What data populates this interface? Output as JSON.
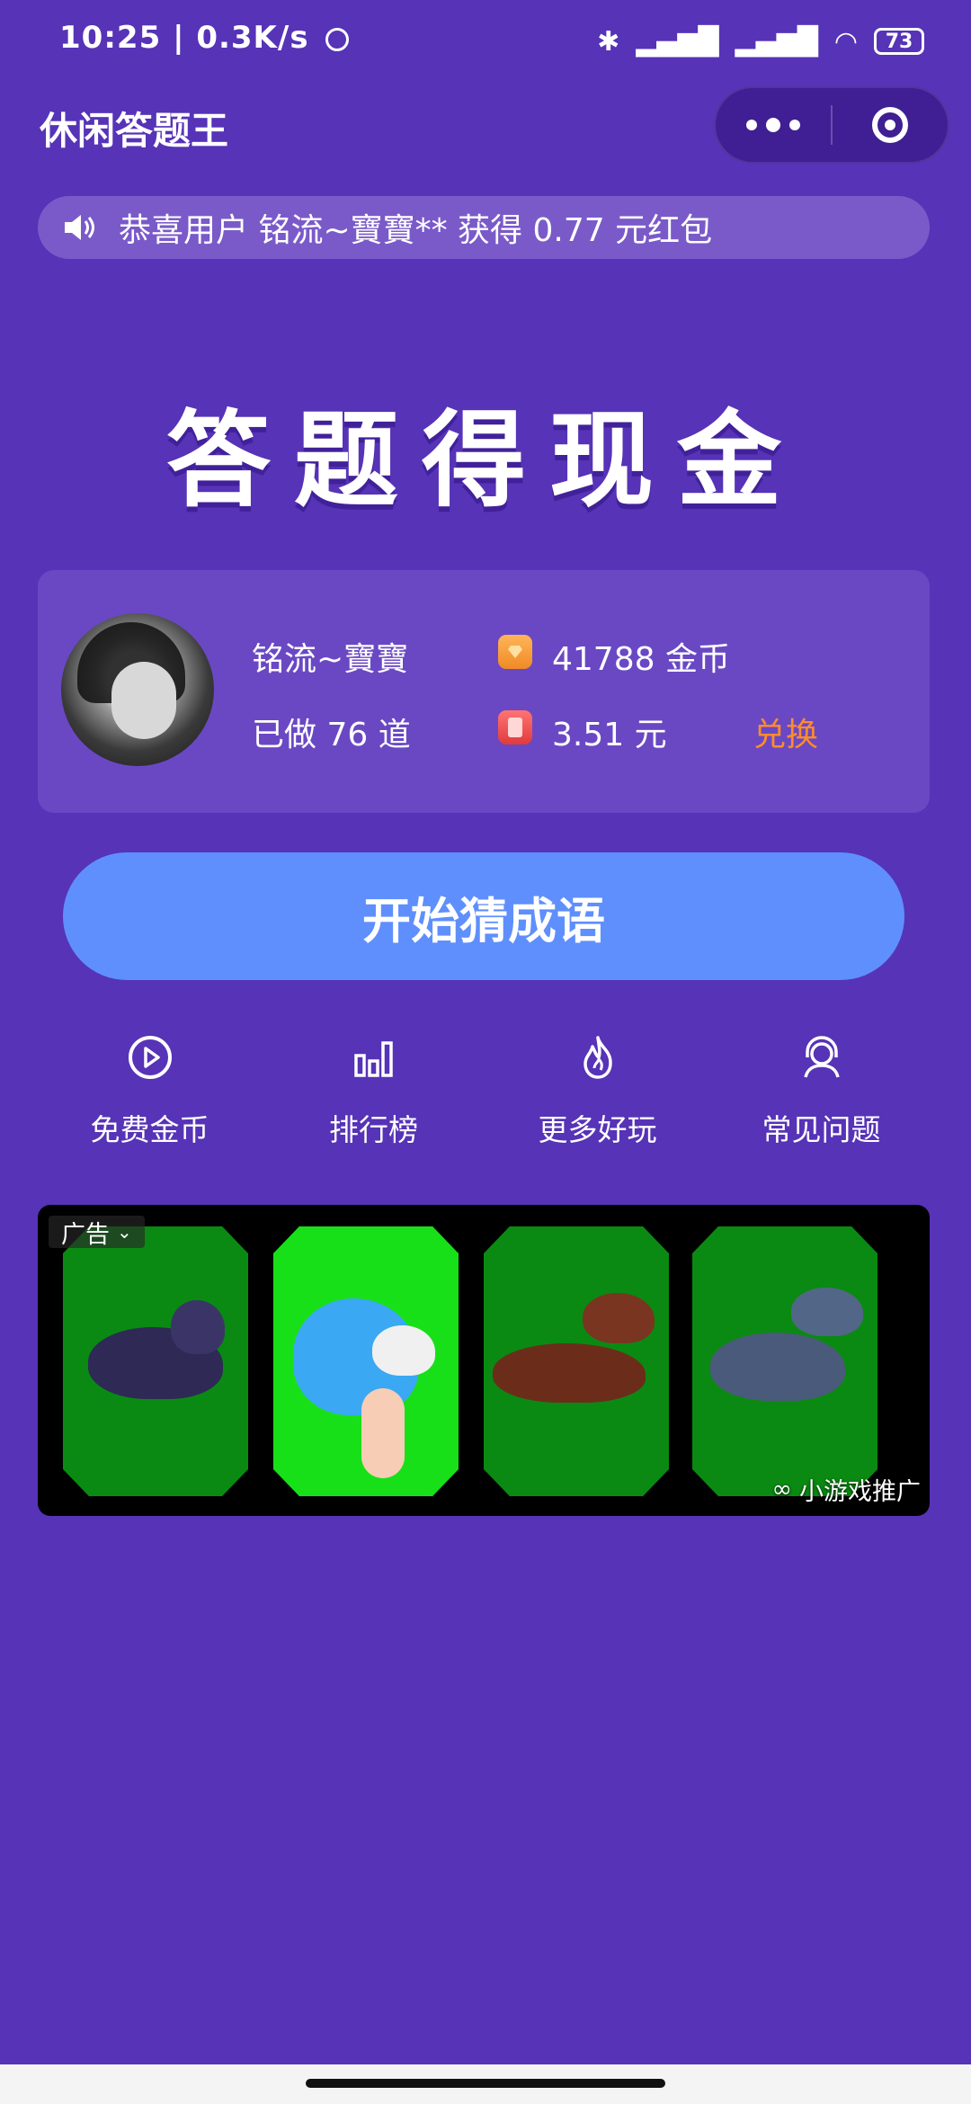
{
  "status_bar": {
    "time": "10:25",
    "speed": "0.3K/s",
    "battery": "73"
  },
  "header": {
    "title": "休闲答题王"
  },
  "notice": {
    "text": "恭喜用户 铭流~寶寶** 获得 0.77 元红包"
  },
  "hero": {
    "title": "答题得现金"
  },
  "profile": {
    "username": "铭流~寶寶",
    "answered": "已做 76 道",
    "coins": "41788 金币",
    "cash": "3.51 元",
    "exchange_label": "兑换"
  },
  "start_button": {
    "label": "开始猜成语"
  },
  "actions": [
    {
      "label": "免费金币",
      "icon": "play-circle-icon"
    },
    {
      "label": "排行榜",
      "icon": "bar-chart-icon"
    },
    {
      "label": "更多好玩",
      "icon": "flame-icon"
    },
    {
      "label": "常见问题",
      "icon": "support-agent-icon"
    }
  ],
  "ad": {
    "tag": "广告",
    "source": "小游戏推广"
  },
  "colors": {
    "background": "#5633b7",
    "card": "#6a48c4",
    "button": "#5e8ffd",
    "exchange": "#ff8c2a"
  }
}
